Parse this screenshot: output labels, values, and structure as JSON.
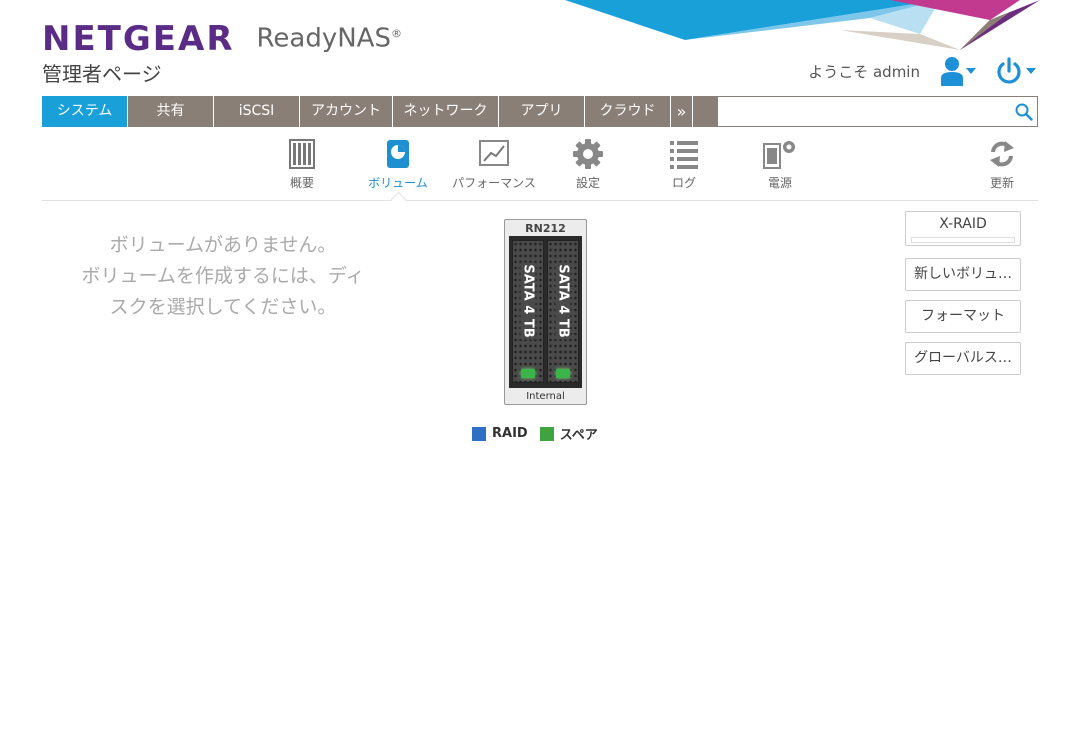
{
  "brand": {
    "logo": "NETGEAR",
    "product": "ReadyNAS",
    "reg": "®",
    "subtitle": "管理者ページ"
  },
  "user": {
    "welcome": "ようこそ admin",
    "user_icon": "user-icon",
    "power_icon": "power-icon"
  },
  "nav": {
    "tabs": [
      {
        "label": "システム",
        "active": true
      },
      {
        "label": "共有"
      },
      {
        "label": "iSCSI"
      },
      {
        "label": "アカウント"
      },
      {
        "label": "ネットワーク"
      },
      {
        "label": "アプリ"
      },
      {
        "label": "クラウド"
      }
    ],
    "more": "»",
    "search_placeholder": ""
  },
  "subnav": [
    {
      "label": "概要",
      "icon": "overview-icon"
    },
    {
      "label": "ボリューム",
      "icon": "volume-icon",
      "active": true
    },
    {
      "label": "パフォーマンス",
      "icon": "performance-icon"
    },
    {
      "label": "設定",
      "icon": "gear-icon"
    },
    {
      "label": "ログ",
      "icon": "log-icon"
    },
    {
      "label": "電源",
      "icon": "power-settings-icon"
    },
    {
      "label": "更新",
      "icon": "refresh-icon"
    }
  ],
  "message": {
    "lines": [
      "ボリュームがありません。",
      "ボリュームを作成するには、ディ",
      "スクを選択してください。"
    ]
  },
  "device": {
    "model": "RN212",
    "location": "Internal",
    "disks": [
      {
        "label": "SATA 4 TB"
      },
      {
        "label": "SATA 4 TB"
      }
    ]
  },
  "legend": {
    "raid": "RAID",
    "spare": "スペア"
  },
  "actions": {
    "xraid": "X-RAID",
    "new_volume": "新しいボリュ…",
    "format": "フォーマット",
    "global": "グローバルス…"
  },
  "colors": {
    "brand": "#5b2c86",
    "nav": "#8a7f77",
    "active_tab": "#1aa0d8",
    "raid": "#2f6fc4",
    "spare": "#3fa33f"
  }
}
